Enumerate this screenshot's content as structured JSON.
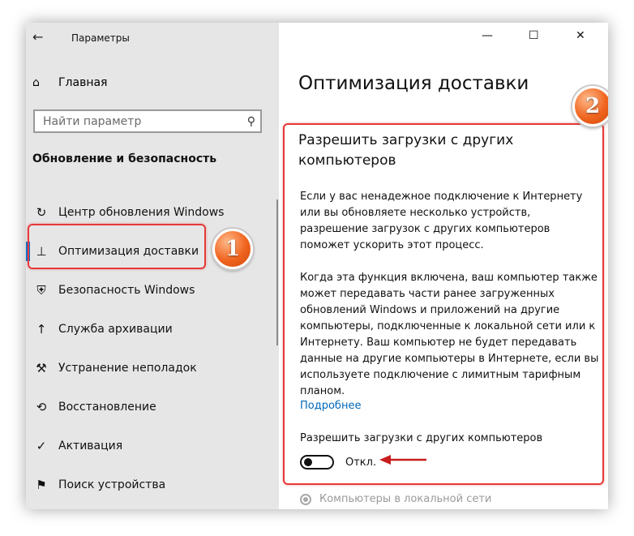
{
  "window": {
    "title": "Параметры",
    "back_icon": "←",
    "minimize_icon": "—",
    "maximize_icon": "☐",
    "close_icon": "✕"
  },
  "sidebar": {
    "home": {
      "icon": "⌂",
      "label": "Главная"
    },
    "search": {
      "placeholder": "Найти параметр",
      "icon": "⚲"
    },
    "section_title": "Обновление и безопасность",
    "items": [
      {
        "icon": "↻",
        "label": "Центр обновления Windows",
        "active": false
      },
      {
        "icon": "⊥",
        "label": "Оптимизация доставки",
        "active": true
      },
      {
        "icon": "⛨",
        "label": "Безопасность Windows",
        "active": false
      },
      {
        "icon": "↑",
        "label": "Служба архивации",
        "active": false
      },
      {
        "icon": "⚒",
        "label": "Устранение неполадок",
        "active": false
      },
      {
        "icon": "⟲",
        "label": "Восстановление",
        "active": false
      },
      {
        "icon": "✓",
        "label": "Активация",
        "active": false
      },
      {
        "icon": "⚑",
        "label": "Поиск устройства",
        "active": false
      }
    ]
  },
  "annotations": {
    "badge1": "1",
    "badge2": "2"
  },
  "main": {
    "page_title": "Оптимизация доставки",
    "section_heading": "Разрешить загрузки с других компьютеров",
    "paragraph1": "Если у вас ненадежное подключение к Интернету или вы обновляете несколько устройств, разрешение загрузок с других компьютеров поможет ускорить этот процесс.",
    "paragraph2": "Когда эта функция включена, ваш компьютер также может передавать части ранее загруженных обновлений Windows и приложений на другие компьютеры, подключенные к локальной сети или к Интернету. Ваш компьютер не будет передавать данные на другие компьютеры в Интернете, если вы используете подключение с лимитным тарифным планом.",
    "more_link": "Подробнее",
    "toggle_label": "Разрешить загрузки с других компьютеров",
    "toggle_state": "Откл.",
    "radio_label": "Компьютеры в локальной сети"
  },
  "colors": {
    "accent": "#0078d7",
    "link": "#0067b8",
    "highlight": "#e63939",
    "badge": "#f0641e"
  }
}
